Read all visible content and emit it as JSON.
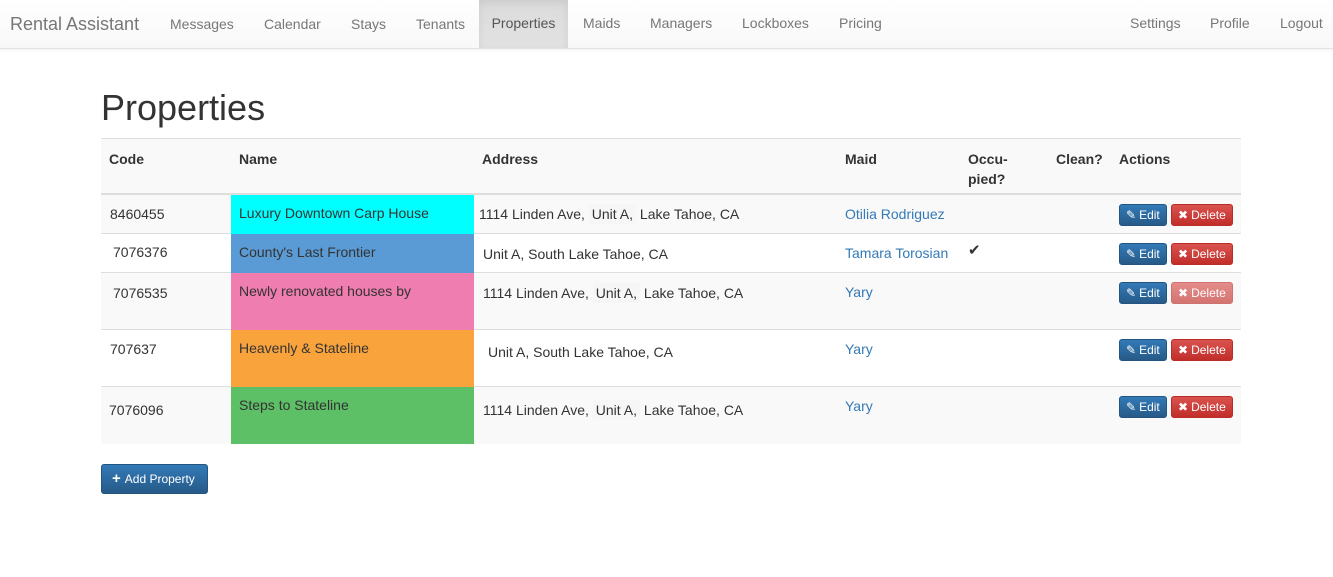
{
  "navbar": {
    "brand": "Rental Assistant",
    "items": [
      "Messages",
      "Calendar",
      "Stays",
      "Tenants",
      "Properties",
      "Maids",
      "Managers",
      "Lockboxes",
      "Pricing"
    ],
    "right_items": [
      "Settings",
      "Profile",
      "Logout"
    ],
    "active": "Properties"
  },
  "page": {
    "title": "Properties"
  },
  "table": {
    "headers": {
      "code": "Code",
      "name": "Name",
      "address": "Address",
      "maid": "Maid",
      "occupied_1": "Occu-",
      "occupied_2": "pied?",
      "clean": "Clean?",
      "actions": "Actions"
    },
    "rows": [
      {
        "code": "8460455",
        "name": "Luxury Downtown Carp House",
        "color": "#00ffff",
        "addr_street": "1114 Linden Ave,",
        "addr_unit": "Unit A,",
        "addr_city": "Lake Tahoe, CA",
        "maid": "Otilia Rodriguez",
        "occupied": "",
        "clean": ""
      },
      {
        "code": "7076376",
        "name": "County's Last Frontier",
        "color": "#5b9bd5",
        "addr_street": "",
        "addr_unit": "Unit A,",
        "addr_city": "South Lake Tahoe, CA",
        "maid": "Tamara Torosian",
        "occupied": "✔",
        "clean": ""
      },
      {
        "code": "7076535",
        "name": "Newly renovated houses by",
        "color": "#f07db0",
        "addr_street": "1114 Linden Ave,",
        "addr_unit": "Unit A,",
        "addr_city": "Lake Tahoe, CA",
        "maid": "Yary",
        "occupied": "",
        "clean": ""
      },
      {
        "code": "707637",
        "name": "Heavenly & Stateline",
        "color": "#f9a33d",
        "addr_street": "",
        "addr_unit": "Unit A,",
        "addr_city": "South Lake Tahoe, CA",
        "maid": "Yary",
        "occupied": "",
        "clean": ""
      },
      {
        "code": "7076096",
        "name": "Steps to Stateline",
        "color": "#5dbf66",
        "addr_street": "1114 Linden Ave,",
        "addr_unit": "Unit A,",
        "addr_city": "Lake Tahoe, CA",
        "maid": "Yary",
        "occupied": "",
        "clean": ""
      }
    ],
    "edit_label": "Edit",
    "delete_label": "Delete"
  },
  "add_button": {
    "label": "Add Property"
  },
  "colors": {
    "accent": "#337ab7",
    "danger": "#d9534f"
  }
}
